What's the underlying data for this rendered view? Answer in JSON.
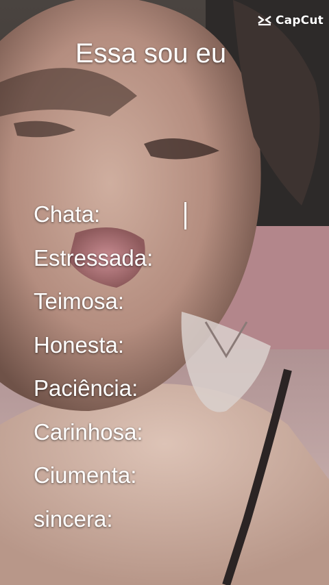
{
  "watermark": {
    "label": "CapCut",
    "icon": "capcut-logo-icon"
  },
  "title": "Essa sou eu",
  "traits": [
    "Chata:",
    "Estressada:",
    "Teimosa:",
    "Honesta:",
    "Paciência:",
    "Carinhosa:",
    "Ciumenta:",
    "sincera:"
  ],
  "colors": {
    "text": "#ffffff",
    "skin": "#c8a493",
    "background_pink": "#b58f93"
  }
}
